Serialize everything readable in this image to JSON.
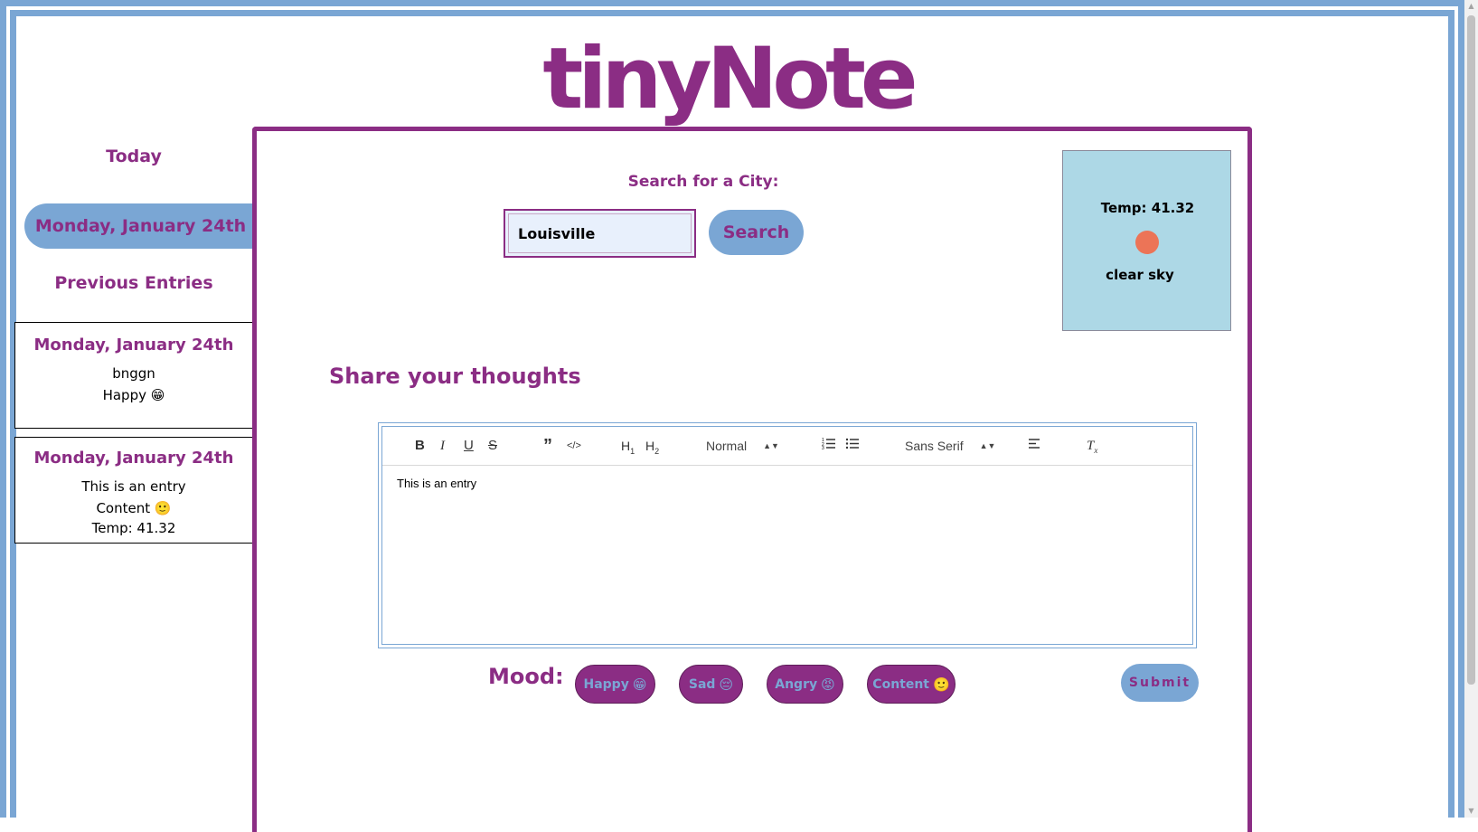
{
  "app": {
    "title": "tinyNote"
  },
  "sidebar": {
    "today_heading": "Today",
    "today_date": "Monday, January 24th",
    "previous_heading": "Previous Entries",
    "entries": [
      {
        "date": "Monday, January 24th",
        "text": "bnggn",
        "mood": "Happy",
        "mood_emoji": "😁",
        "temp": ""
      },
      {
        "date": "Monday, January 24th",
        "text": "This is an entry",
        "mood": "Content",
        "mood_emoji": "🙂",
        "temp": "Temp: 41.32"
      }
    ]
  },
  "search": {
    "label": "Search for a City:",
    "value": "Louisville",
    "button_label": "Search"
  },
  "weather": {
    "temp": "Temp: 41.32",
    "description": "clear sky",
    "icon": "sun-dot-icon",
    "icon_color": "#ec7457"
  },
  "editor": {
    "heading": "Share your thoughts",
    "header_select": "Normal",
    "font_select": "Sans Serif",
    "content": "This is an entry",
    "toolbar_icons": [
      "bold-icon",
      "italic-icon",
      "underline-icon",
      "strikethrough-icon",
      "blockquote-icon",
      "code-block-icon",
      "h1-icon",
      "h2-icon",
      "ordered-list-icon",
      "bullet-list-icon",
      "align-icon",
      "clear-format-icon"
    ]
  },
  "mood": {
    "label": "Mood:",
    "options": [
      {
        "label": "Happy",
        "emoji": "😁"
      },
      {
        "label": "Sad",
        "emoji": "😔"
      },
      {
        "label": "Angry",
        "emoji": "😡"
      },
      {
        "label": "Content",
        "emoji": "🙂"
      }
    ],
    "submit_label": "Submit"
  },
  "colors": {
    "brand_purple": "#8b2d84",
    "accent_blue": "#7aa6d4",
    "weather_bg": "#add8e6"
  }
}
